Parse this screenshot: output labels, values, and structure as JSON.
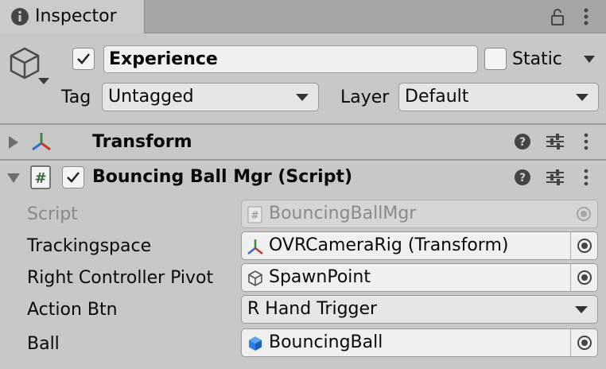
{
  "window": {
    "tab_label": "Inspector",
    "tab_icon": "info-icon",
    "lock_icon": "lock-icon",
    "menu_icon": "kebab-menu-icon"
  },
  "gameobject": {
    "icon": "cube-icon",
    "active": true,
    "name": "Experience",
    "static_label": "Static",
    "static_checked": false,
    "tag_label": "Tag",
    "tag_value": "Untagged",
    "layer_label": "Layer",
    "layer_value": "Default"
  },
  "components": {
    "transform": {
      "title": "Transform",
      "icon": "transform-axes-icon",
      "expanded": false
    },
    "script": {
      "title": "Bouncing Ball Mgr (Script)",
      "icon": "script-hash-icon",
      "enabled": true,
      "expanded": true
    }
  },
  "properties": [
    {
      "label": "Script",
      "value": "BouncingBallMgr",
      "icon": "script-hash-icon",
      "type": "object",
      "disabled": true
    },
    {
      "label": "Trackingspace",
      "value": "OVRCameraRig (Transform)",
      "icon": "transform-axes-icon",
      "type": "object",
      "disabled": false
    },
    {
      "label": "Right Controller Pivot",
      "value": "SpawnPoint",
      "icon": "cube-outline-icon",
      "type": "object",
      "disabled": false
    },
    {
      "label": "Action Btn",
      "value": "R Hand Trigger",
      "type": "enum",
      "disabled": false
    },
    {
      "label": "Ball",
      "value": "BouncingBall",
      "icon": "prefab-cube-icon",
      "type": "object",
      "disabled": false
    }
  ],
  "colors": {
    "panel_bg": "#c8c8c8",
    "tab_bar_bg": "#a5a5a5",
    "field_bg": "#f0f0f0",
    "axis_red": "#c0392b",
    "axis_green": "#3a8c3a",
    "axis_blue": "#2f6fd6",
    "prefab_blue": "#2a7de1"
  }
}
